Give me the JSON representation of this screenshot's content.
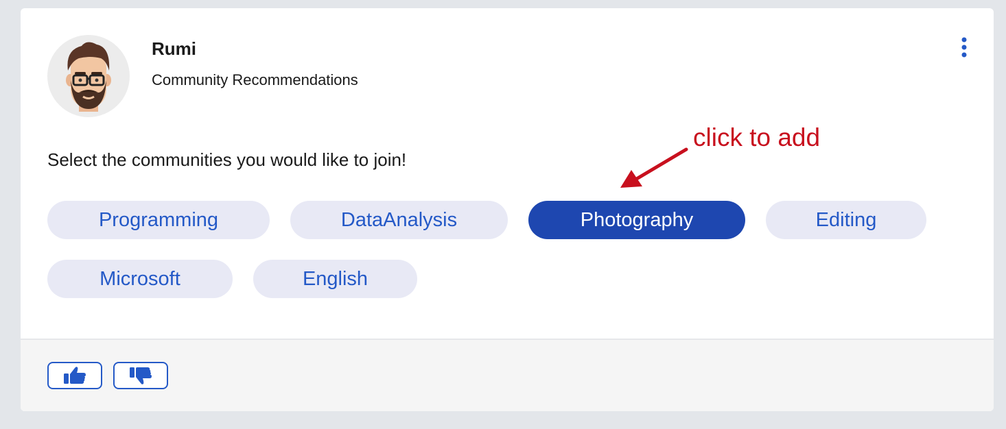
{
  "post": {
    "author_name": "Rumi",
    "subtitle": "Community Recommendations",
    "prompt": "Select the communities you would like to join!"
  },
  "annotation": {
    "text": "click to add",
    "color": "#c8101e"
  },
  "communities": [
    {
      "label": "Programming",
      "selected": false
    },
    {
      "label": "DataAnalysis",
      "selected": false
    },
    {
      "label": "Photography",
      "selected": true
    },
    {
      "label": "Editing",
      "selected": false
    },
    {
      "label": "Microsoft",
      "selected": false
    },
    {
      "label": "English",
      "selected": false
    }
  ],
  "icons": {
    "more": "more-vertical-icon",
    "like": "thumbs-up-icon",
    "dislike": "thumbs-down-icon"
  },
  "colors": {
    "accent": "#2459c7",
    "chip_bg": "#e8e9f5",
    "chip_selected_bg": "#1e47b0"
  }
}
